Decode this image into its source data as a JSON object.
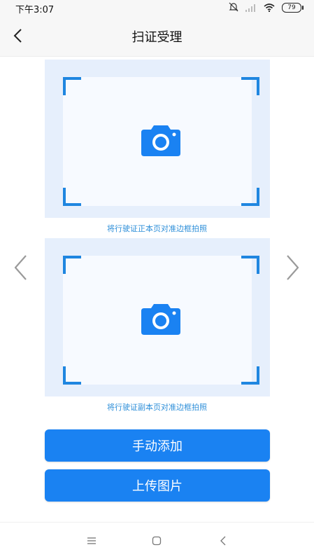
{
  "status_bar": {
    "time": "下午3:07",
    "battery": "79"
  },
  "header": {
    "title": "扫证受理"
  },
  "front_card": {
    "caption": "将行驶证正本页对准边框拍照"
  },
  "back_card": {
    "caption": "将行驶证副本页对准边框拍照"
  },
  "buttons": {
    "manual_add": "手动添加",
    "upload_image": "上传图片"
  },
  "colors": {
    "accent": "#1a82f2",
    "frame": "#1f86e0",
    "card_bg": "#e6effc",
    "caption": "#2e8fd9"
  }
}
